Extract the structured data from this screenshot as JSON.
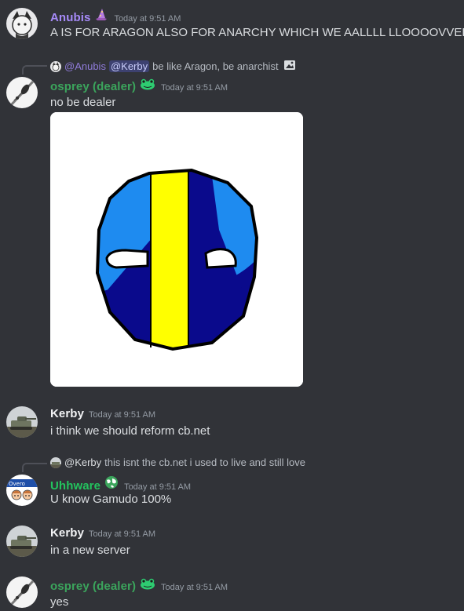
{
  "messages": [
    {
      "username": "Anubis",
      "username_color": "#a78bfa",
      "timestamp": "Today at 9:51 AM",
      "text": "A IS FOR ARAGON ALSO FOR ANARCHY WHICH WE AALLLL LLOOOOVVEEE"
    },
    {
      "reply": {
        "mention_author": "@Anubis",
        "mention_tag": "@Kerby",
        "text": "be like Aragon, be anarchist"
      },
      "username": "osprey (dealer)",
      "username_color": "#3ba55c",
      "timestamp": "Today at 9:51 AM",
      "text": "no be dealer"
    },
    {
      "username": "Kerby",
      "username_color": "#f2f3f5",
      "timestamp": "Today at 9:51 AM",
      "text": "i think we should reform cb.net"
    },
    {
      "reply": {
        "author": "@Kerby",
        "text": "this isnt the cb.net i used to live and still love"
      },
      "username": "Uhhware",
      "username_color": "#23c45e",
      "timestamp": "Today at 9:51 AM",
      "text": "U know Gamudo 100%",
      "avatar_text": "Overo"
    },
    {
      "username": "Kerby",
      "username_color": "#f2f3f5",
      "timestamp": "Today at 9:51 AM",
      "text": "in a new server"
    },
    {
      "username": "osprey (dealer)",
      "username_color": "#3ba55c",
      "timestamp": "Today at 9:51 AM",
      "text": "yes"
    }
  ],
  "icons": {
    "anubis_badge": "wizard-hat-icon",
    "osprey_badge": "frog-icon",
    "uhhware_badge": "globe-icon",
    "reply_image": "image-icon"
  },
  "colors": {
    "background": "#313338",
    "text": "#dbdee1",
    "muted": "#949ba4",
    "ball_light_blue": "#1e8bf0",
    "ball_dark_blue": "#0a0a8c",
    "ball_yellow": "#ffff00"
  }
}
